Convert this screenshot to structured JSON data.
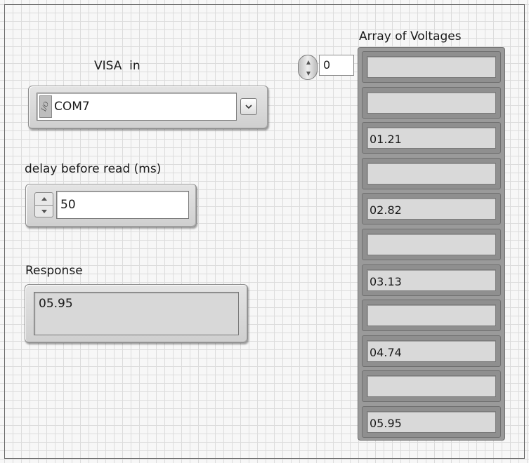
{
  "visa": {
    "label": "VISA  in",
    "io_glyph": "I/O",
    "value": "COM7"
  },
  "delay": {
    "label": "delay before read (ms)",
    "value": "50"
  },
  "response": {
    "label": "Response",
    "value": "05.95"
  },
  "array": {
    "label": "Array of Voltages",
    "index": "0",
    "elements": [
      "",
      "",
      "01.21",
      "",
      "02.82",
      "",
      "03.13",
      "",
      "04.74",
      "",
      "05.95"
    ]
  }
}
